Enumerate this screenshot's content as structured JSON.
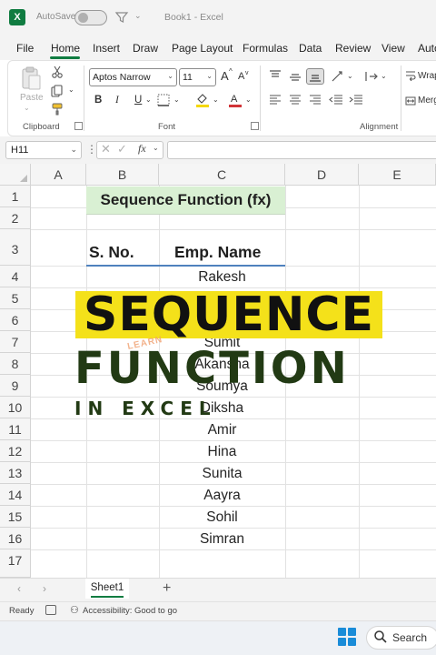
{
  "app": {
    "autosave_label": "AutoSave",
    "doc_title": "Book1  -  Excel",
    "logo_letter": "X"
  },
  "menu": {
    "items": [
      "File",
      "Home",
      "Insert",
      "Draw",
      "Page Layout",
      "Formulas",
      "Data",
      "Review",
      "View",
      "Auto"
    ],
    "active": "Home"
  },
  "ribbon": {
    "clipboard": {
      "label": "Clipboard",
      "paste_label": "Paste"
    },
    "font": {
      "label": "Font",
      "font_name": "Aptos Narrow",
      "font_size": "11",
      "grow_label": "A",
      "shrink_label": "A",
      "bold": "B",
      "italic": "I",
      "underline": "U"
    },
    "alignment": {
      "label": "Alignment",
      "wrap_label": "Wrap",
      "merge_label": "Merg"
    }
  },
  "formula_bar": {
    "cell_ref": "H11",
    "fx_label": "fx",
    "value": ""
  },
  "grid": {
    "columns": [
      "A",
      "B",
      "C",
      "D",
      "E"
    ],
    "rows": [
      "1",
      "2",
      "3",
      "4",
      "5",
      "6",
      "7",
      "8",
      "9",
      "10",
      "11",
      "12",
      "13",
      "14",
      "15",
      "16",
      "17"
    ],
    "title_cell": "Sequence Function (fx)",
    "header_sno": "S. No.",
    "header_name": "Emp. Name",
    "names": [
      "Rakesh",
      "",
      "",
      "Sumit",
      "Akansha",
      "Soumya",
      "Diksha",
      "Amir",
      "Hina",
      "Sunita",
      "Aayra",
      "Sohil",
      "Simran"
    ]
  },
  "overlay": {
    "line1": "SEQUENCE",
    "line2": "FUNCTION",
    "line3": "IN EXCEL",
    "watermark": "LEARN",
    "accent_yellow": "#f4e11a",
    "dark_green": "#223a14"
  },
  "sheets": {
    "tabs": [
      "Sheet1"
    ],
    "add_label": "+"
  },
  "status": {
    "ready": "Ready",
    "accessibility": "Accessibility: Good to go"
  },
  "taskbar": {
    "search_label": "Search"
  },
  "colors": {
    "excel_green": "#107c41",
    "title_fill": "#d9f0d3",
    "header_underline": "#4f81bd"
  }
}
